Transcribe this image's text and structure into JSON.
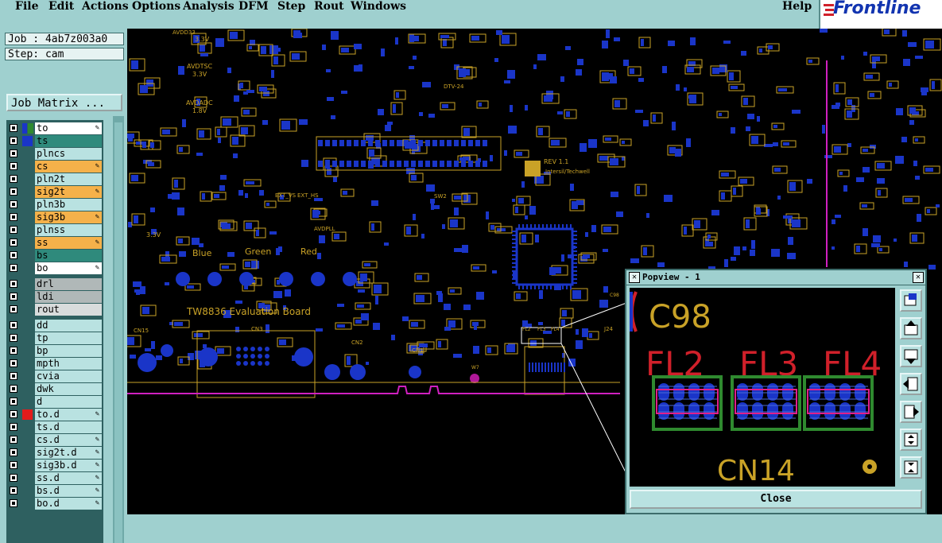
{
  "menu": {
    "file": "File",
    "edit": "Edit",
    "actions": "Actions",
    "options": "Options",
    "analysis": "Analysis",
    "dfm": "DFM",
    "step": "Step",
    "rout": "Rout",
    "windows": "Windows",
    "help": "Help"
  },
  "logo": "Frontline",
  "job": "Job : 4ab7z003a0",
  "step": "Step: cam",
  "job_matrix": "Job Matrix ...",
  "layers": [
    {
      "name": "to",
      "color": "#ffffff",
      "swatch": "#1a35c8",
      "swatch2": "#2f8a2f",
      "editable": true
    },
    {
      "name": "ts",
      "color": "#2f8a7c",
      "swatch": "#1a35c8",
      "editable": false
    },
    {
      "name": "plncs",
      "color": "#b9e2e1",
      "editable": false
    },
    {
      "name": "cs",
      "color": "#f5b14a",
      "editable": true
    },
    {
      "name": "pln2t",
      "color": "#b9e2e1",
      "editable": false
    },
    {
      "name": "sig2t",
      "color": "#f5b14a",
      "editable": true
    },
    {
      "name": "pln3b",
      "color": "#b9e2e1",
      "editable": false
    },
    {
      "name": "sig3b",
      "color": "#f5b14a",
      "editable": true
    },
    {
      "name": "plnss",
      "color": "#b9e2e1",
      "editable": false
    },
    {
      "name": "ss",
      "color": "#f5b14a",
      "editable": true
    },
    {
      "name": "bs",
      "color": "#2f8a7c",
      "editable": false
    },
    {
      "name": "bo",
      "color": "#ffffff",
      "editable": true
    },
    {
      "name": "drl",
      "color": "#b0b8b8",
      "editable": false
    },
    {
      "name": "ldi",
      "color": "#b0b8b8",
      "editable": false
    },
    {
      "name": "rout",
      "color": "#d8dcdc",
      "editable": false
    },
    {
      "name": "dd",
      "color": "#b9e2e1",
      "editable": false
    },
    {
      "name": "tp",
      "color": "#b9e2e1",
      "editable": false
    },
    {
      "name": "bp",
      "color": "#b9e2e1",
      "editable": false
    },
    {
      "name": "mpth",
      "color": "#b9e2e1",
      "editable": false
    },
    {
      "name": "cvia",
      "color": "#b9e2e1",
      "editable": false
    },
    {
      "name": "dwk",
      "color": "#b9e2e1",
      "editable": false
    },
    {
      "name": "d",
      "color": "#b9e2e1",
      "editable": false
    },
    {
      "name": "to.d",
      "color": "#b9e2e1",
      "swatch": "#e31b1b",
      "editable": true
    },
    {
      "name": "ts.d",
      "color": "#b9e2e1",
      "editable": false
    },
    {
      "name": "cs.d",
      "color": "#b9e2e1",
      "editable": true
    },
    {
      "name": "sig2t.d",
      "color": "#b9e2e1",
      "editable": true
    },
    {
      "name": "sig3b.d",
      "color": "#b9e2e1",
      "editable": true
    },
    {
      "name": "ss.d",
      "color": "#b9e2e1",
      "editable": true
    },
    {
      "name": "bs.d",
      "color": "#b9e2e1",
      "editable": true
    },
    {
      "name": "bo.d",
      "color": "#b9e2e1",
      "editable": true
    }
  ],
  "board": {
    "title": "TW8836 Evaluation Board",
    "rev": "REV 1.1",
    "company": "Intersil/Techwell",
    "labels": [
      "Blue",
      "Green",
      "Red",
      "CN15",
      "CN3",
      "CN2",
      "CN1",
      "J24",
      "AVDD33",
      "3.3V",
      "AVDTSC",
      "3.3V",
      "AVDADC",
      "1.8V",
      "DTV-24",
      "EXT_VS",
      "EXT_HS",
      "AVDPLL",
      "SW2",
      "REV 1.1",
      "3.3V",
      "FL2",
      "FL3",
      "FL4",
      "C98",
      "W7"
    ]
  },
  "popview": {
    "title": "Popview - 1",
    "close": "Close",
    "labels": {
      "c98": "C98",
      "fl2": "FL2",
      "fl3": "FL3",
      "fl4": "FL4",
      "cn14": "CN14"
    }
  }
}
